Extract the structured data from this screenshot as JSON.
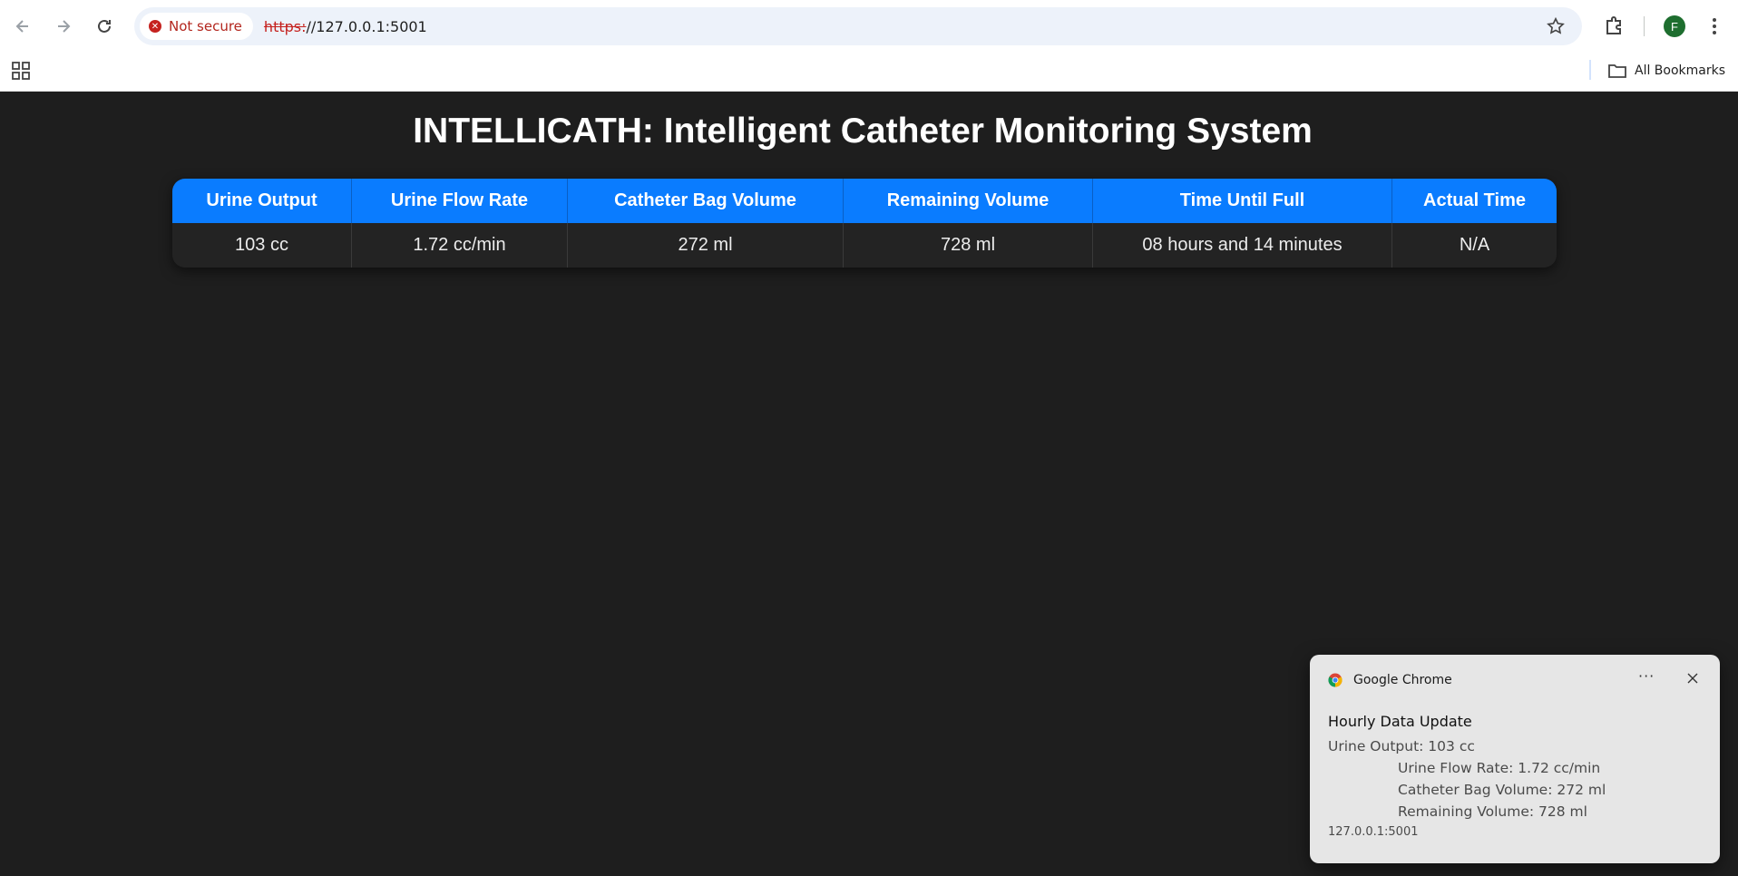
{
  "browser": {
    "security_label": "Not secure",
    "url_scheme": "https:",
    "url_rest": "//127.0.0.1:5001",
    "profile_initial": "F",
    "all_bookmarks": "All Bookmarks"
  },
  "page": {
    "title": "INTELLICATH: Intelligent Catheter Monitoring System",
    "table": {
      "headers": [
        "Urine Output",
        "Urine Flow Rate",
        "Catheter Bag Volume",
        "Remaining Volume",
        "Time Until Full",
        "Actual Time"
      ],
      "row": [
        "103 cc",
        "1.72 cc/min",
        "272 ml",
        "728 ml",
        "08 hours and 14 minutes",
        "N/A"
      ]
    }
  },
  "notification": {
    "app": "Google Chrome",
    "more": "···",
    "title": "Hourly Data Update",
    "lines": [
      "Urine Output: 103 cc",
      "Urine Flow Rate: 1.72 cc/min",
      "Catheter Bag Volume: 272 ml",
      "Remaining Volume: 728 ml"
    ],
    "origin": "127.0.0.1:5001"
  },
  "colors": {
    "accent": "#0a7cff",
    "page_bg": "#1e1e1e",
    "not_secure": "#c5221f"
  }
}
